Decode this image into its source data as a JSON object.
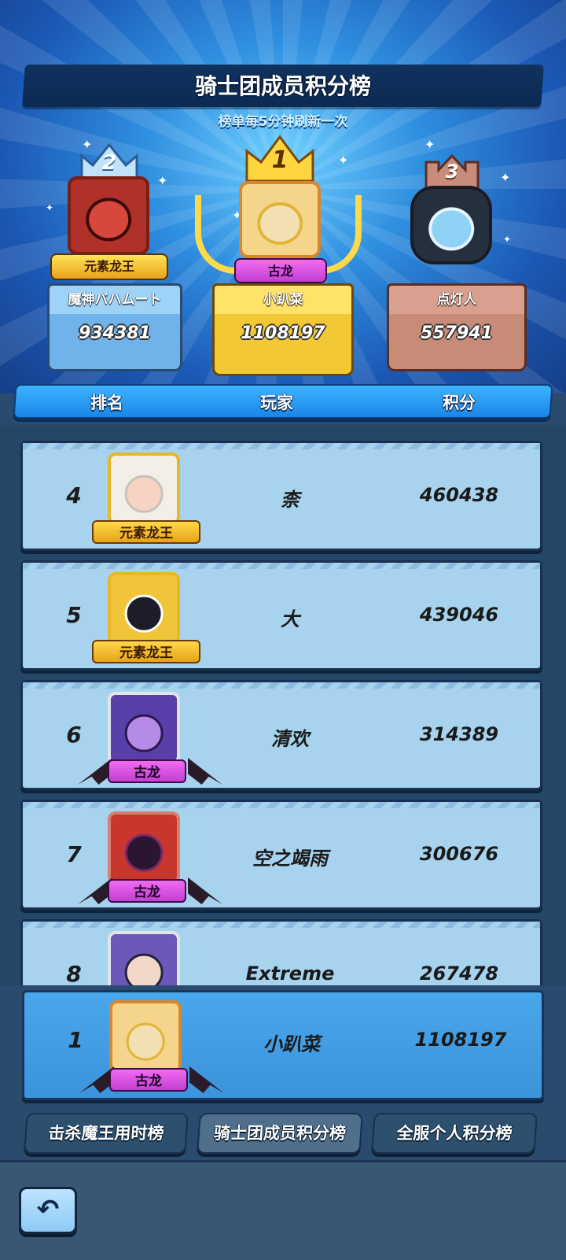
{
  "header": {
    "title": "骑士团成员积分榜",
    "subtitle": "榜单每5分钟刷新一次"
  },
  "podium": [
    {
      "rank": "2",
      "title": "元素龙王",
      "name": "魔神バハムート",
      "score": "934381"
    },
    {
      "rank": "1",
      "title": "古龙",
      "name": "小趴菜",
      "score": "1108197"
    },
    {
      "rank": "3",
      "name": "点灯人",
      "score": "557941"
    }
  ],
  "columns": {
    "rank": "排名",
    "player": "玩家",
    "score": "积分"
  },
  "list": [
    {
      "rank": "4",
      "title": "元素龙王",
      "name": "柰",
      "score": "460438"
    },
    {
      "rank": "5",
      "title": "元素龙王",
      "name": "大",
      "score": "439046"
    },
    {
      "rank": "6",
      "title": "古龙",
      "name": "清欢",
      "score": "314389"
    },
    {
      "rank": "7",
      "title": "古龙",
      "name": "空之竭雨",
      "score": "300676"
    },
    {
      "rank": "8",
      "name": "Extreme",
      "score": "267478"
    }
  ],
  "my_entry": {
    "rank": "1",
    "title": "古龙",
    "name": "小趴菜",
    "score": "1108197"
  },
  "tabs": [
    {
      "label": "击杀魔王用时榜"
    },
    {
      "label": "骑士团成员积分榜"
    },
    {
      "label": "全服个人积分榜"
    }
  ],
  "icons": {
    "back": "back-arrow-icon"
  }
}
